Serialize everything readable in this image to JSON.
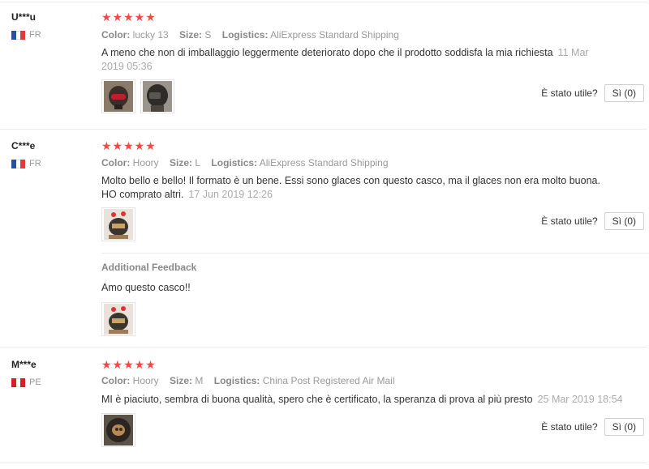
{
  "reviews": [
    {
      "user": "U***u",
      "country": "FR",
      "flag": [
        "#1f4fa8",
        "#ffffff",
        "#e33"
      ],
      "stars": "★★★★★",
      "color_label": "Color:",
      "color_value": "lucky 13",
      "size_label": "Size:",
      "size_value": "S",
      "logistics_label": "Logistics:",
      "logistics_value": "AliExpress Standard Shipping",
      "text": "A meno che non di imballaggio leggermente deteriorato dopo che il prodotto soddisfa la mia richiesta",
      "date": "11 Mar 2019 05:36",
      "helpful_label": "È stato utile?",
      "helpful_button": "Sì (0)",
      "thumbnails": [
        "helmet-photo-1",
        "helmet-photo-2"
      ]
    },
    {
      "user": "C***e",
      "country": "FR",
      "flag": [
        "#1f4fa8",
        "#ffffff",
        "#e33"
      ],
      "stars": "★★★★★",
      "color_label": "Color:",
      "color_value": "Hoory",
      "size_label": "Size:",
      "size_value": "L",
      "logistics_label": "Logistics:",
      "logistics_value": "AliExpress Standard Shipping",
      "text": "Molto bello e bello! Il formato è un bene. Essi sono glaces con questo casco, ma il glaces non era molto buona. HO comprato altri.",
      "date": "17 Jun 2019 12:26",
      "helpful_label": "È stato utile?",
      "helpful_button": "Sì (0)",
      "thumbnails": [
        "helmet-photo-3"
      ],
      "additional_feedback": {
        "title": "Additional Feedback",
        "text": "Amo questo casco!!",
        "thumbnails": [
          "helmet-photo-4"
        ]
      }
    },
    {
      "user": "M***e",
      "country": "PE",
      "flag": [
        "#d91f26",
        "#ffffff",
        "#d91f26"
      ],
      "stars": "★★★★★",
      "color_label": "Color:",
      "color_value": "Hoory",
      "size_label": "Size:",
      "size_value": "M",
      "logistics_label": "Logistics:",
      "logistics_value": "China Post Registered Air Mail",
      "text": "MI è piaciuto, sembra di buona qualità, spero che è certificato, la speranza di prova al più presto",
      "date": "25 Mar 2019 18:54",
      "helpful_label": "È stato utile?",
      "helpful_button": "Sì (0)",
      "thumbnails": [
        "helmet-photo-5"
      ]
    }
  ]
}
